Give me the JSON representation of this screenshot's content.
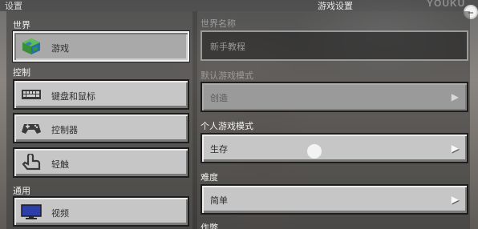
{
  "header": {
    "left_title": "设置",
    "page_title": "游戏设置",
    "watermark": "YOUKU"
  },
  "sidebar": {
    "sections": [
      {
        "label": "世界",
        "items": [
          {
            "label": "游戏",
            "icon": "world-globe-icon",
            "selected": true
          }
        ]
      },
      {
        "label": "控制",
        "items": [
          {
            "label": "键盘和鼠标",
            "icon": "keyboard-icon",
            "selected": false
          },
          {
            "label": "控制器",
            "icon": "gamepad-icon",
            "selected": false
          },
          {
            "label": "轻触",
            "icon": "touch-hand-icon",
            "selected": false
          }
        ]
      },
      {
        "label": "通用",
        "items": [
          {
            "label": "视频",
            "icon": "monitor-icon",
            "selected": false
          }
        ]
      }
    ]
  },
  "settings": {
    "world_name": {
      "label": "世界名称",
      "value": "新手教程",
      "enabled": false
    },
    "default_game_mode": {
      "label": "默认游戏模式",
      "value": "创造",
      "enabled": false
    },
    "personal_game_mode": {
      "label": "个人游戏模式",
      "value": "生存",
      "enabled": true
    },
    "difficulty": {
      "label": "难度",
      "value": "简单",
      "enabled": true
    },
    "next_section_label": "作弊"
  },
  "colors": {
    "button_face": "#c6c6c6",
    "button_selected": "#a9a9a9",
    "button_disabled": "#9a9a9a",
    "label_disabled": "#9c9c9c"
  }
}
